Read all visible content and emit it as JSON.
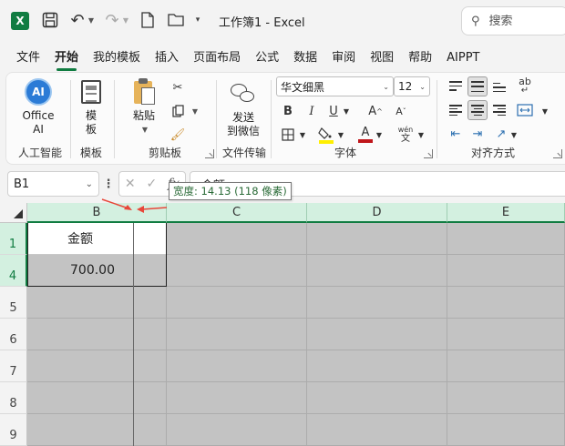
{
  "titlebar": {
    "logo": "X",
    "doc_title": "工作簿1 - Excel",
    "search_placeholder": "搜索"
  },
  "tabs": [
    "文件",
    "开始",
    "我的模板",
    "插入",
    "页面布局",
    "公式",
    "数据",
    "审阅",
    "视图",
    "帮助",
    "AIPPT"
  ],
  "active_tab": "开始",
  "ribbon": {
    "ai": {
      "icon_text": "AI",
      "label1": "Office",
      "label2": "AI",
      "group": "人工智能"
    },
    "template": {
      "label1": "模",
      "label2": "板",
      "group": "模板"
    },
    "clipboard": {
      "paste": "粘贴",
      "group": "剪贴板"
    },
    "file_transfer": {
      "label1": "发送",
      "label2": "到微信",
      "group": "文件传输"
    },
    "font": {
      "name": "华文细黑",
      "size": "12",
      "bold": "B",
      "italic": "I",
      "underline": "U",
      "grow": "A",
      "shrink": "A",
      "font_color": "A",
      "phonetic_top": "wén",
      "phonetic_bottom": "文",
      "group": "字体"
    },
    "alignment": {
      "wrap": "ab",
      "group": "对齐方式"
    }
  },
  "formula_bar": {
    "name_box": "B1",
    "formula": "金额",
    "fx": "fx"
  },
  "tooltip": "宽度: 14.13 (118 像素)",
  "columns": [
    "B",
    "C",
    "D",
    "E"
  ],
  "rows": [
    "1",
    "4",
    "5",
    "6",
    "7",
    "8",
    "9"
  ],
  "cells": {
    "b1": "金额",
    "b4": "700.00"
  },
  "colors": {
    "accent": "#107c41",
    "header_selected": "#d3f0e0",
    "hidden_gray": "#c3c3c3",
    "arrow": "#e8473a"
  }
}
